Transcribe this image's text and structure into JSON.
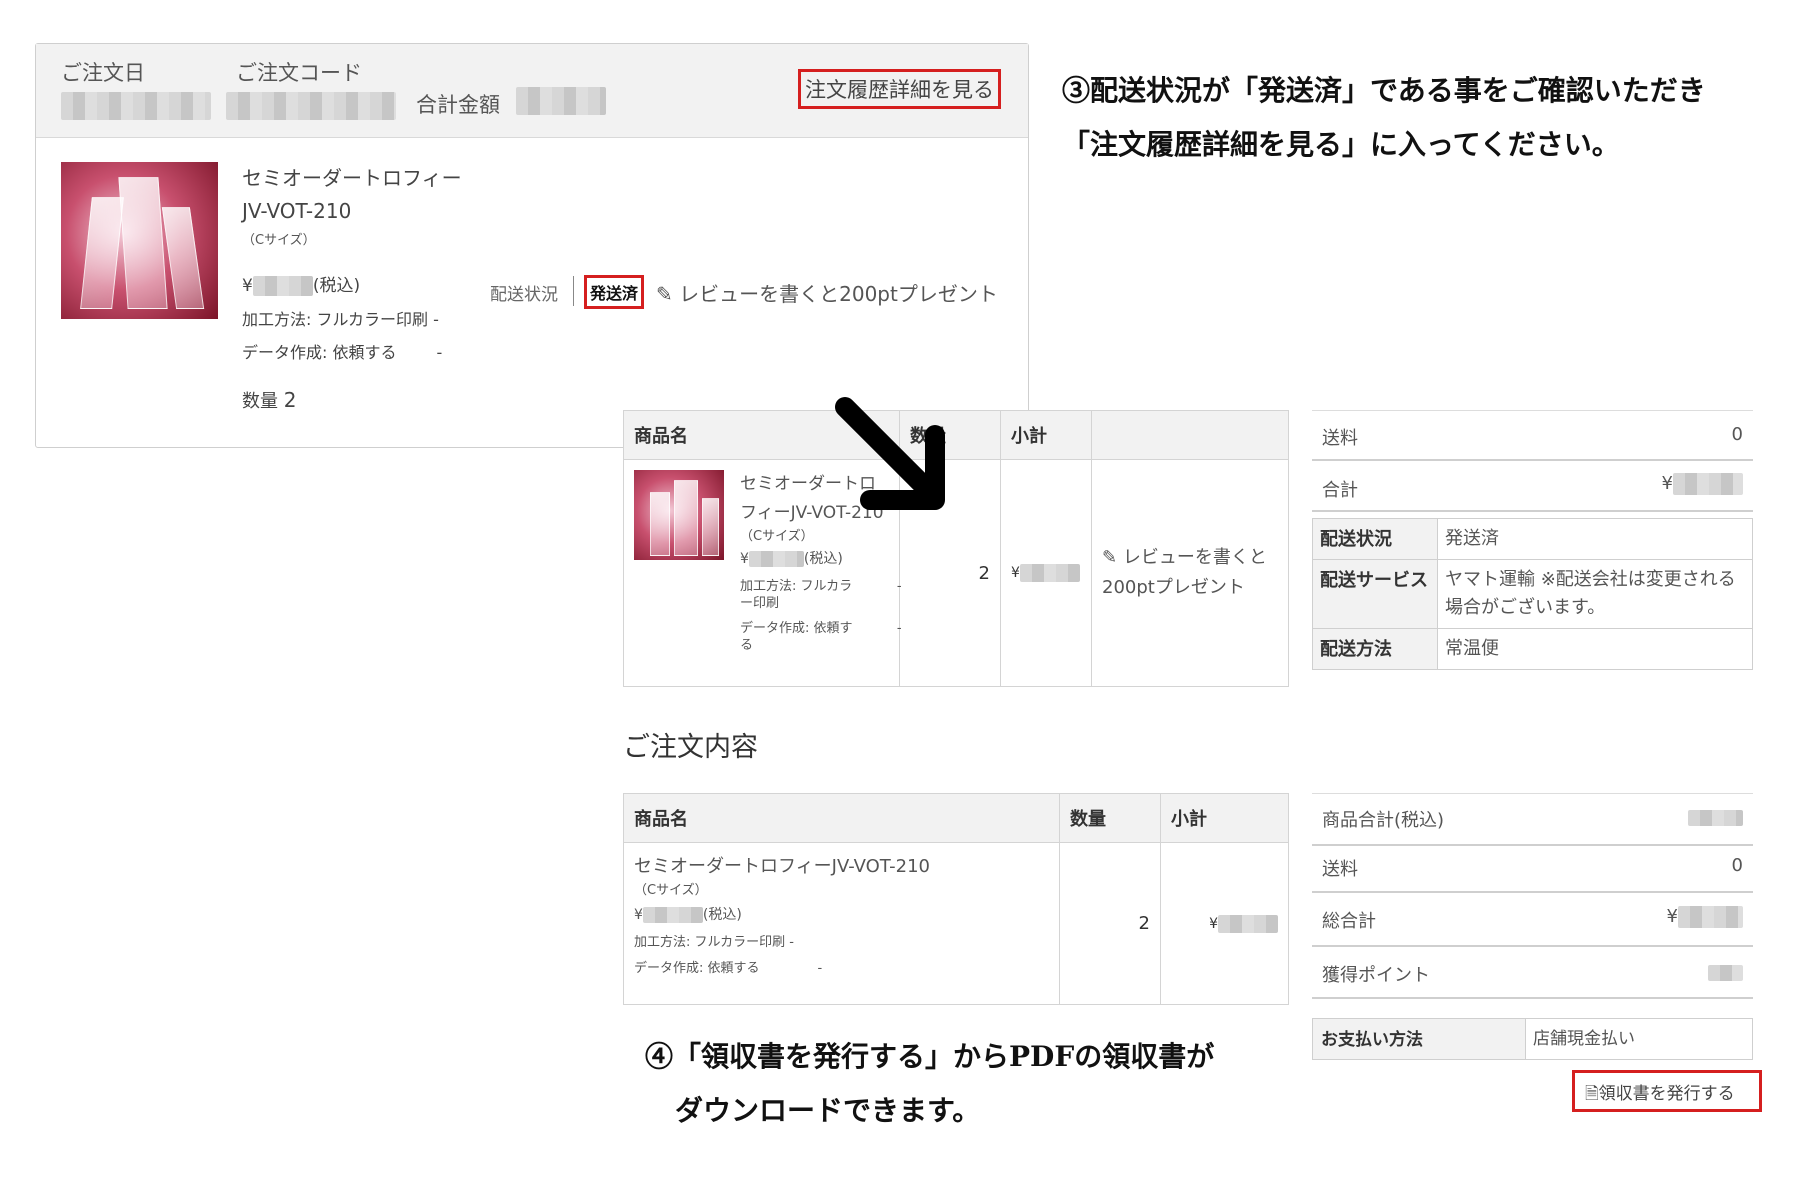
{
  "order_card": {
    "order_date_label": "ご注文日",
    "order_code_label": "ご注文コード",
    "total_label": "合計金額",
    "detail_link": "注文履歴詳細を見る",
    "product_name_line1": "セミオーダートロフィー",
    "product_name_line2": "JV-VOT-210",
    "size": "（Cサイズ）",
    "price_prefix": "¥",
    "tax_note": "(税込)",
    "option1": "加工方法: フルカラー印刷 -",
    "option2": "データ作成: 依頼する",
    "option2_suffix": "-",
    "quantity_label": "数量",
    "quantity_value": "2",
    "shipping_status_label": "配送状況",
    "shipping_status_value": "発送済",
    "review_link": "レビューを書くと200ptプレゼント"
  },
  "annotations": {
    "step3_line1": "③配送状況が「発送済」である事をご確認いただき",
    "step3_line2": "「注文履歴詳細を見る」に入ってください。",
    "step4_line1": "④「領収書を発行する」からPDFの領収書が",
    "step4_line2": "ダウンロードできます。"
  },
  "detail_table": {
    "headers": [
      "商品名",
      "数量",
      "小計",
      ""
    ],
    "product_line1": "セミオーダートロ",
    "product_line2": "フィーJV-VOT-210",
    "size": "（Cサイズ）",
    "price_prefix": "¥",
    "tax_note": "(税込)",
    "option1_line1": "加工方法: フルカラ",
    "option1_line2": "ー印刷",
    "option2_line1": "データ作成: 依頼す",
    "option2_line2": "る",
    "option_dash": "-",
    "quantity": "2",
    "subtotal_prefix": "¥",
    "review_line1": "レビューを書くと",
    "review_line2": "200ptプレゼント"
  },
  "detail_summary": {
    "shipping_fee_label": "送料",
    "shipping_fee_value": "0",
    "total_label": "合計",
    "total_prefix": "¥",
    "status_label": "配送状況",
    "status_value": "発送済",
    "service_label": "配送サービス",
    "service_value": "ヤマト運輸 ※配送会社は変更される場合がございます。",
    "method_label": "配送方法",
    "method_value": "常温便"
  },
  "order_contents": {
    "title": "ご注文内容",
    "headers": [
      "商品名",
      "数量",
      "小計"
    ],
    "product_name": "セミオーダートロフィーJV-VOT-210",
    "size": "（Cサイズ）",
    "price_prefix": "¥",
    "tax_note": "(税込)",
    "option1": "加工方法: フルカラー印刷 -",
    "option2": "データ作成: 依頼する",
    "option2_suffix": "-",
    "quantity": "2",
    "subtotal_prefix": "¥"
  },
  "contents_summary": {
    "goods_total_label": "商品合計(税込)",
    "shipping_label": "送料",
    "shipping_value": "0",
    "grand_total_label": "総合計",
    "grand_total_prefix": "¥",
    "points_label": "獲得ポイント",
    "payment_label": "お支払い方法",
    "payment_value": "店舗現金払い",
    "receipt_button": "領収書を発行する"
  },
  "colors": {
    "highlight": "#d51f1f",
    "header_bg": "#f2f2f2",
    "arrow": "#000000"
  }
}
